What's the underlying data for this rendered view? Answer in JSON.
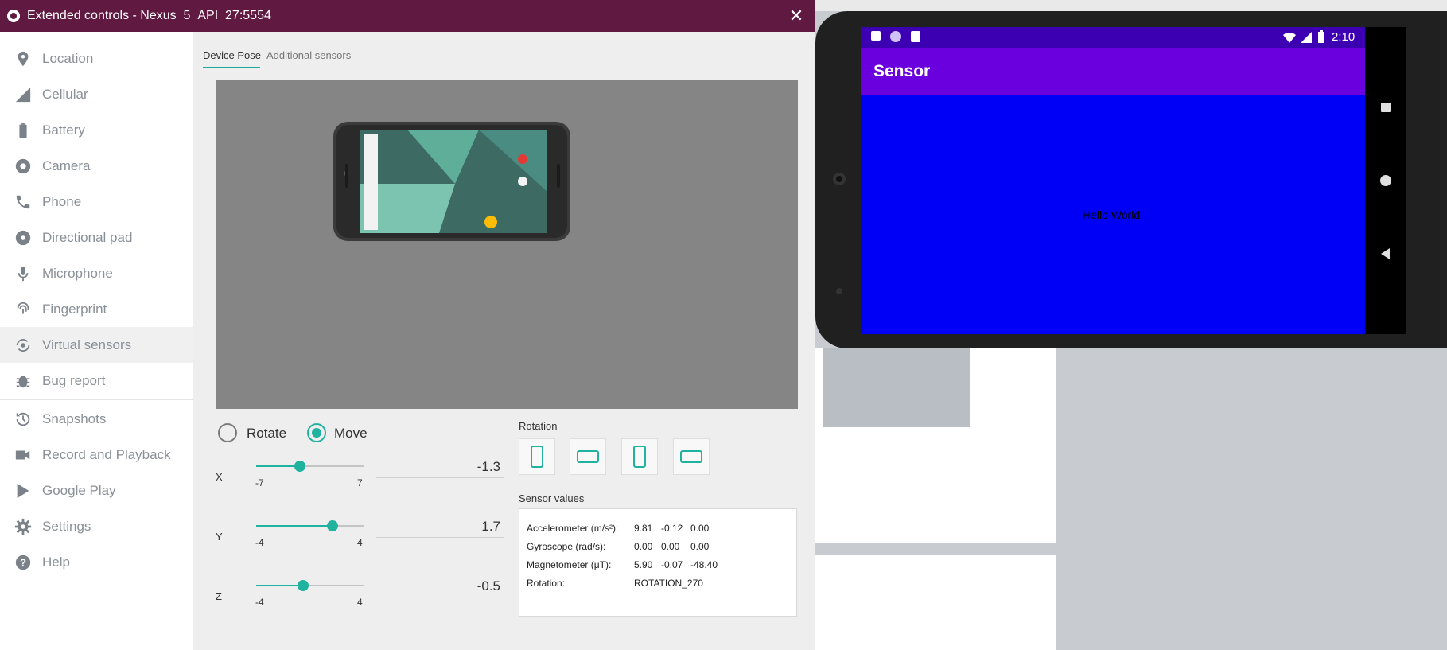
{
  "window": {
    "title": "Extended controls - Nexus_5_API_27:5554",
    "close_glyph": "✕"
  },
  "sidebar": {
    "items": [
      {
        "label": "Location",
        "icon": "location-pin-icon"
      },
      {
        "label": "Cellular",
        "icon": "cellular-icon"
      },
      {
        "label": "Battery",
        "icon": "battery-icon"
      },
      {
        "label": "Camera",
        "icon": "camera-aperture-icon"
      },
      {
        "label": "Phone",
        "icon": "phone-icon"
      },
      {
        "label": "Directional pad",
        "icon": "dpad-icon"
      },
      {
        "label": "Microphone",
        "icon": "microphone-icon"
      },
      {
        "label": "Fingerprint",
        "icon": "fingerprint-icon"
      },
      {
        "label": "Virtual sensors",
        "icon": "virtual-sensors-icon",
        "active": true
      },
      {
        "label": "Bug report",
        "icon": "bug-icon"
      },
      {
        "label": "Snapshots",
        "icon": "history-icon"
      },
      {
        "label": "Record and Playback",
        "icon": "video-camera-icon"
      },
      {
        "label": "Google Play",
        "icon": "play-store-icon"
      },
      {
        "label": "Settings",
        "icon": "gear-icon"
      },
      {
        "label": "Help",
        "icon": "help-icon"
      }
    ]
  },
  "tabs": {
    "active": "Device Pose",
    "inactive": "Additional sensors"
  },
  "mode": {
    "rotate_label": "Rotate",
    "move_label": "Move",
    "selected": "Move"
  },
  "sliders": {
    "x": {
      "label": "X",
      "min": "-7",
      "max": "7",
      "value": "-1.3",
      "fraction": 0.407
    },
    "y": {
      "label": "Y",
      "min": "-4",
      "max": "4",
      "value": "1.7",
      "fraction": 0.7125
    },
    "z": {
      "label": "Z",
      "min": "-4",
      "max": "4",
      "value": "-0.5",
      "fraction": 0.4375
    }
  },
  "rotation": {
    "label": "Rotation",
    "buttons": [
      "portrait",
      "landscape",
      "reverse-portrait",
      "reverse-landscape"
    ]
  },
  "sensor_values": {
    "label": "Sensor values",
    "rows": [
      {
        "name": "Accelerometer (m/s²):",
        "values": [
          "9.81",
          "-0.12",
          "0.00"
        ]
      },
      {
        "name": "Gyroscope (rad/s):",
        "values": [
          "0.00",
          "0.00",
          "0.00"
        ]
      },
      {
        "name": "Magnetometer (μT):",
        "values": [
          "5.90",
          "-0.07",
          "-48.40"
        ]
      },
      {
        "name": "Rotation:",
        "values": [
          "ROTATION_270"
        ]
      }
    ]
  },
  "emulator": {
    "time": "2:10",
    "app_title": "Sensor",
    "content_text": "Hello World!",
    "colors": {
      "status_bar": "#3c00b2",
      "app_bar": "#6a00dd",
      "content": "#0000f7",
      "accent": "#1fb29f",
      "titlebar": "#601941"
    }
  }
}
